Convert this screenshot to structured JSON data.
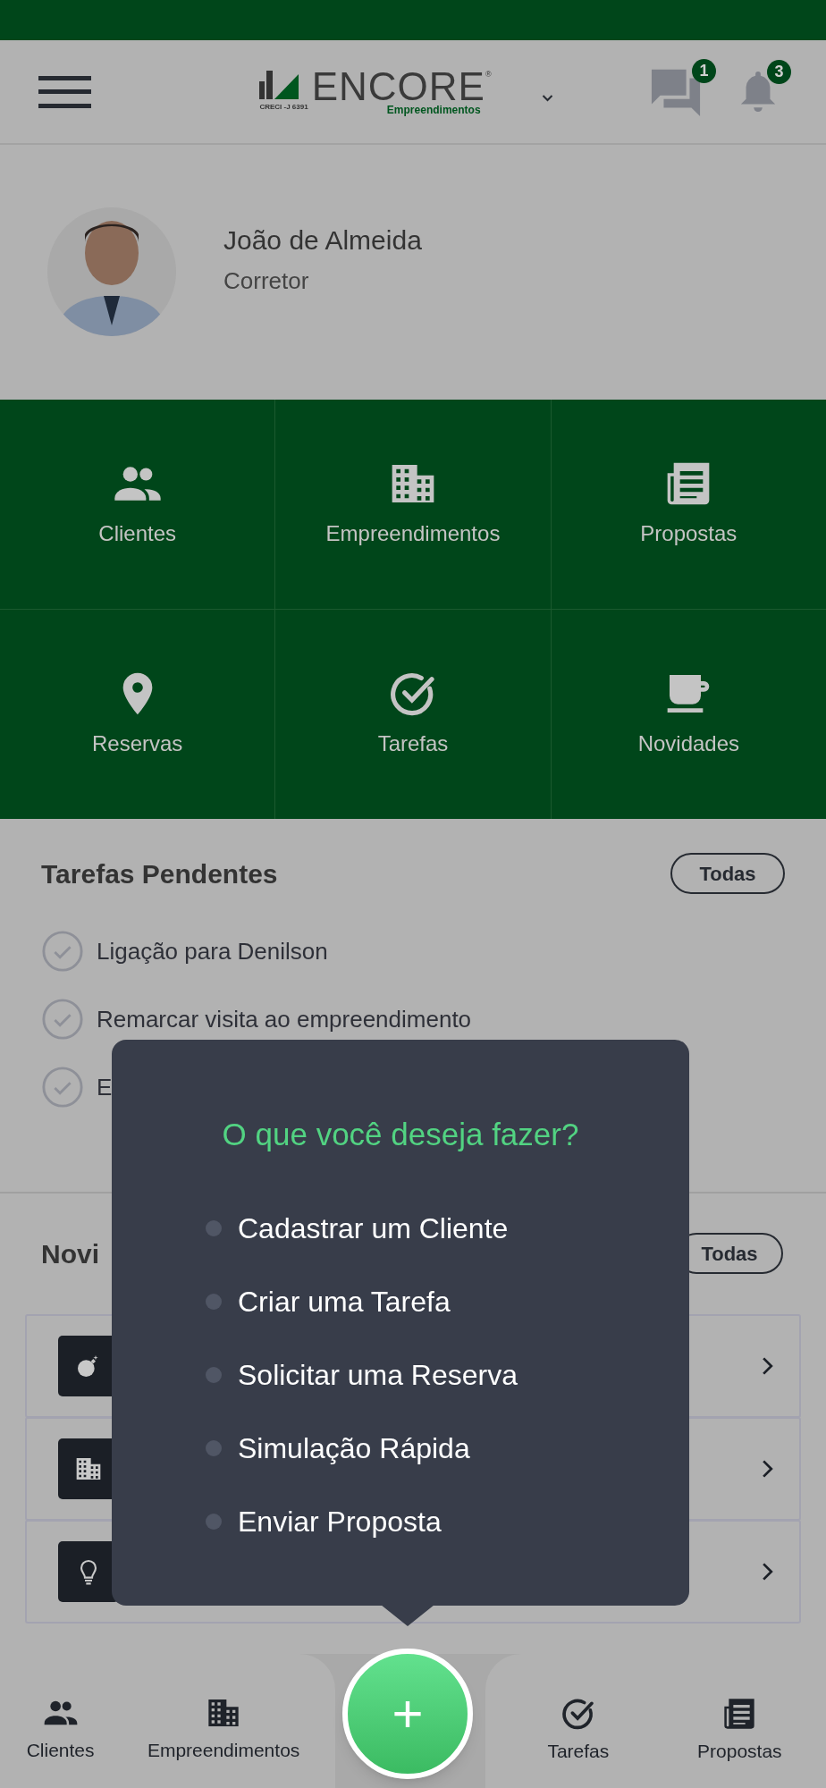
{
  "header": {
    "logo": {
      "name": "ENCORE",
      "registered": "®",
      "subtitle": "Empreendimentos",
      "license": "CRECI -J 6391"
    },
    "messages_badge": "1",
    "notifications_badge": "3"
  },
  "profile": {
    "name": "João de Almeida",
    "role": "Corretor"
  },
  "shortcuts": [
    {
      "label": "Clientes",
      "kind": "people"
    },
    {
      "label": "Empreendimentos",
      "kind": "building"
    },
    {
      "label": "Propostas",
      "kind": "document"
    },
    {
      "label": "Reservas",
      "kind": "pin"
    },
    {
      "label": "Tarefas",
      "kind": "check"
    },
    {
      "label": "Novidades",
      "kind": "cup"
    }
  ],
  "pending_tasks": {
    "title": "Tarefas Pendentes",
    "button": "Todas",
    "items": [
      "Ligação para Denilson",
      "Remarcar visita ao empreendimento",
      "E"
    ]
  },
  "news": {
    "title": "Novi",
    "button": "Todas",
    "items": [
      {
        "kind": "bomb"
      },
      {
        "kind": "building"
      },
      {
        "kind": "bulb"
      }
    ]
  },
  "popup": {
    "title": "O que você deseja fazer?",
    "options": [
      "Cadastrar um Cliente",
      "Criar uma Tarefa",
      "Solicitar uma Reserva",
      "Simulação Rápida",
      "Enviar Proposta"
    ]
  },
  "bottom_nav": {
    "left": [
      {
        "label": "Clientes",
        "kind": "people"
      },
      {
        "label": "Empreendimentos",
        "kind": "building"
      }
    ],
    "fab": "+",
    "right": [
      {
        "label": "Tarefas",
        "kind": "check"
      },
      {
        "label": "Propostas",
        "kind": "document"
      }
    ]
  }
}
